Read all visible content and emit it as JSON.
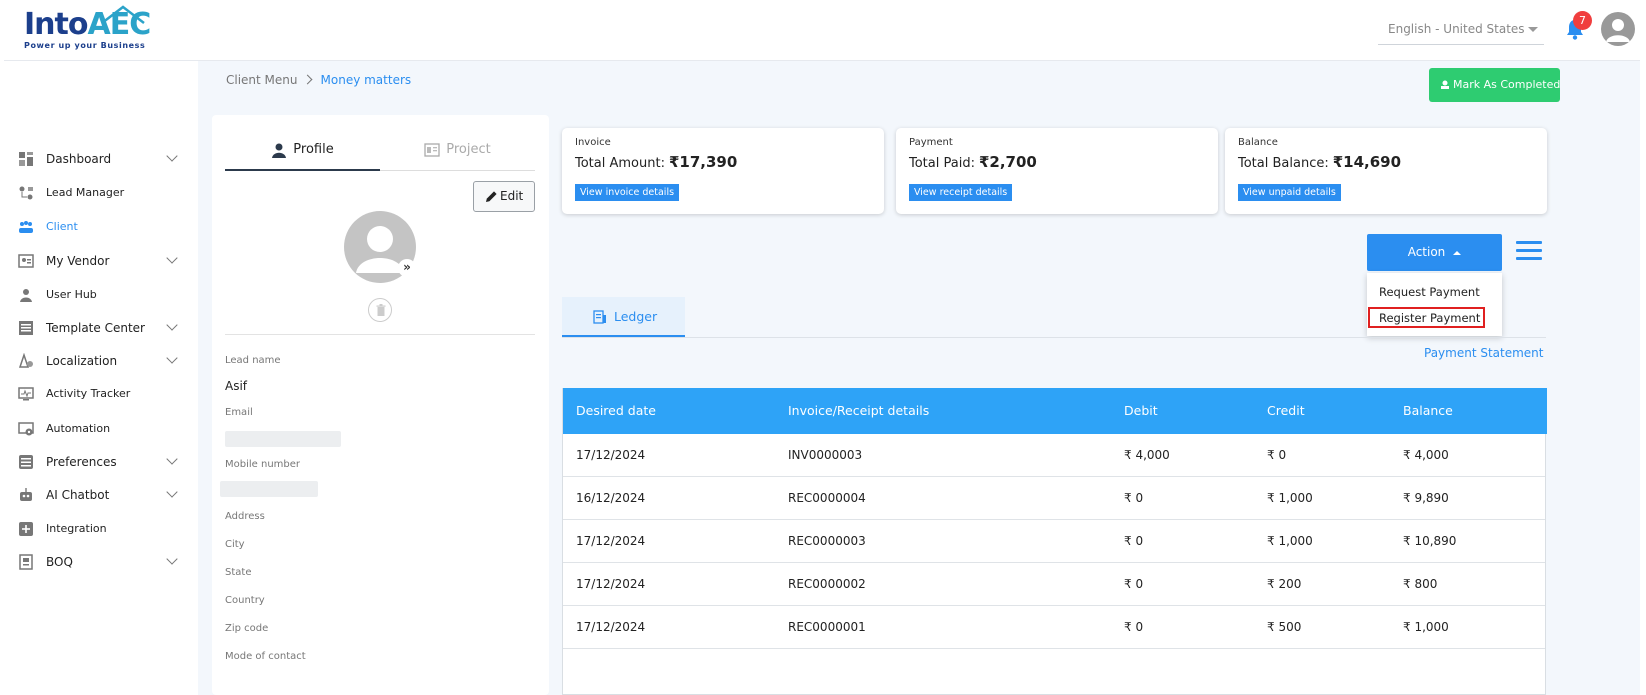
{
  "brand": {
    "name": "IntoAEC",
    "word": "Into",
    "accent": "AEC",
    "tagline": "Power up your Business",
    "primary_color": "#2b8ef0",
    "logo_color": "#1c3f8c"
  },
  "header": {
    "language": "English - United States",
    "notification_count": "7"
  },
  "sidebar": {
    "items": [
      {
        "label": "Dashboard",
        "icon": "dashboard-icon",
        "has_chevron": true
      },
      {
        "label": "Lead Manager",
        "icon": "lead-manager-icon",
        "has_chevron": false
      },
      {
        "label": "Client",
        "icon": "client-icon",
        "has_chevron": false,
        "active": true
      },
      {
        "label": "My Vendor",
        "icon": "vendor-icon",
        "has_chevron": true
      },
      {
        "label": "User Hub",
        "icon": "user-icon",
        "has_chevron": false
      },
      {
        "label": "Template Center",
        "icon": "template-icon",
        "has_chevron": true
      },
      {
        "label": "Localization",
        "icon": "localization-icon",
        "has_chevron": true
      },
      {
        "label": "Activity Tracker",
        "icon": "activity-icon",
        "has_chevron": false
      },
      {
        "label": "Automation",
        "icon": "automation-icon",
        "has_chevron": false
      },
      {
        "label": "Preferences",
        "icon": "preferences-icon",
        "has_chevron": true
      },
      {
        "label": "AI Chatbot",
        "icon": "chatbot-icon",
        "has_chevron": true
      },
      {
        "label": "Integration",
        "icon": "integration-icon",
        "has_chevron": false
      },
      {
        "label": "BOQ",
        "icon": "boq-icon",
        "has_chevron": true
      }
    ]
  },
  "breadcrumb": {
    "parent": "Client Menu",
    "current": "Money matters"
  },
  "mark_completed_label": "Mark As Completed",
  "profile": {
    "tabs": {
      "profile": "Profile",
      "project": "Project"
    },
    "edit_label": "Edit",
    "fields": {
      "lead_name_label": "Lead name",
      "lead_name_value": "Asif",
      "email_label": "Email",
      "mobile_label": "Mobile number",
      "address_label": "Address",
      "city_label": "City",
      "state_label": "State",
      "country_label": "Country",
      "zip_label": "Zip code",
      "contact_label": "Mode of contact"
    }
  },
  "cards": {
    "invoice": {
      "label": "Invoice",
      "title": "Total Amount:",
      "amount": "₹17,390",
      "button": "View invoice details"
    },
    "payment": {
      "label": "Payment",
      "title": "Total Paid:",
      "amount": "₹2,700",
      "button": "View receipt details"
    },
    "balance": {
      "label": "Balance",
      "title": "Total Balance:",
      "amount": "₹14,690",
      "button": "View unpaid details"
    }
  },
  "action": {
    "label": "Action",
    "menu": [
      "Request Payment",
      "Register Payment"
    ]
  },
  "ledger": {
    "tab_label": "Ledger",
    "statement_link": "Payment Statement",
    "columns": [
      "Desired date",
      "Invoice/Receipt details",
      "Debit",
      "Credit",
      "Balance"
    ],
    "rows": [
      [
        "17/12/2024",
        "INV0000003",
        "₹ 4,000",
        "₹ 0",
        "₹ 4,000"
      ],
      [
        "16/12/2024",
        "REC0000004",
        "₹ 0",
        "₹ 1,000",
        "₹ 9,890"
      ],
      [
        "17/12/2024",
        "REC0000003",
        "₹ 0",
        "₹ 1,000",
        "₹ 10,890"
      ],
      [
        "17/12/2024",
        "REC0000002",
        "₹ 0",
        "₹ 200",
        "₹ 800"
      ],
      [
        "17/12/2024",
        "REC0000001",
        "₹ 0",
        "₹ 500",
        "₹ 1,000"
      ]
    ]
  }
}
